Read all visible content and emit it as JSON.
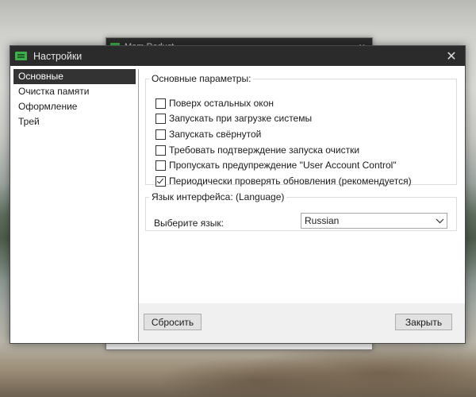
{
  "back_window": {
    "title": "Mem Reduct",
    "minimize_glyph": "—",
    "close_glyph": "✕"
  },
  "dialog": {
    "title": "Настройки",
    "close_glyph": "✕"
  },
  "sidebar": {
    "items": [
      {
        "label": "Основные",
        "selected": true
      },
      {
        "label": "Очистка памяти",
        "selected": false
      },
      {
        "label": "Оформление",
        "selected": false
      },
      {
        "label": "Трей",
        "selected": false
      }
    ]
  },
  "basic_group": {
    "legend": "Основные параметры:",
    "options": [
      {
        "label": "Поверх остальных окон",
        "checked": false
      },
      {
        "label": "Запускать при загрузке системы",
        "checked": false
      },
      {
        "label": "Запускать свёрнутой",
        "checked": false
      },
      {
        "label": "Требовать подтверждение запуска очистки",
        "checked": false
      },
      {
        "label": "Пропускать предупреждение \"User Account Control\"",
        "checked": false
      },
      {
        "label": "Периодически проверять обновления (рекомендуется)",
        "checked": true
      }
    ]
  },
  "language_group": {
    "legend": "Язык интерфейса: (Language)",
    "select_label": "Выберите язык:",
    "selected_value": "Russian"
  },
  "footer": {
    "reset_label": "Сбросить",
    "close_label": "Закрыть"
  },
  "colors": {
    "titlebar": "#2b2b2b",
    "selected_item": "#333333",
    "app_icon": "#3fae4c"
  }
}
